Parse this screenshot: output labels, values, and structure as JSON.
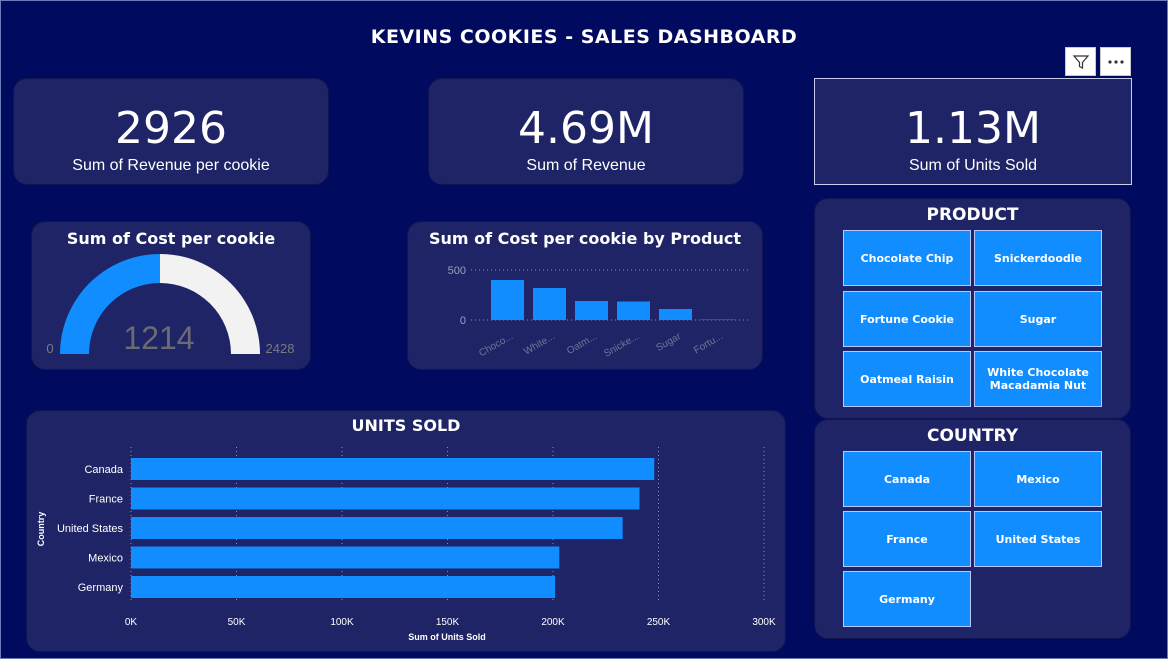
{
  "title": "KEVINS COOKIES - SALES DASHBOARD",
  "toolbar": {
    "filter_icon": "filter-icon",
    "more_icon": "more-options-icon"
  },
  "kpis": [
    {
      "value": "2926",
      "label": "Sum of Revenue per cookie"
    },
    {
      "value": "4.69M",
      "label": "Sum of Revenue"
    },
    {
      "value": "1.13M",
      "label": "Sum of Units Sold"
    }
  ],
  "gauge": {
    "title": "Sum of Cost per cookie",
    "value": 1214,
    "value_label": "1214",
    "min_label": "0",
    "max_label": "2428",
    "fill_fraction": 0.5,
    "colors": {
      "fill": "#118dff",
      "track": "#f2f2f2"
    }
  },
  "product_chart": {
    "title": "Sum of Cost per cookie by Product",
    "ytick_labels": [
      "500",
      "0"
    ]
  },
  "units_chart": {
    "title": "UNITS SOLD",
    "ylabel": "Country",
    "xlabel": "Sum of Units Sold"
  },
  "chart_data": [
    {
      "type": "bar",
      "title": "Sum of Cost per cookie by Product",
      "categories": [
        "Choco...",
        "White...",
        "Oatm...",
        "Snicke...",
        "Sugar",
        "Fortu..."
      ],
      "values": [
        400,
        320,
        190,
        185,
        110,
        5
      ],
      "ylim": [
        0,
        600
      ],
      "yticks": [
        0,
        500
      ],
      "grid": true
    },
    {
      "type": "bar",
      "orientation": "horizontal",
      "title": "UNITS SOLD",
      "categories": [
        "Canada",
        "France",
        "United States",
        "Mexico",
        "Germany"
      ],
      "values": [
        248000,
        241000,
        233000,
        203000,
        201000
      ],
      "xlabel": "Sum of Units Sold",
      "ylabel": "Country",
      "xlim": [
        0,
        300000
      ],
      "xtick_labels": [
        "0K",
        "50K",
        "100K",
        "150K",
        "200K",
        "250K",
        "300K"
      ],
      "grid": true,
      "color": "#118dff"
    }
  ],
  "product_slicer": {
    "title": "PRODUCT",
    "items": [
      "Chocolate Chip",
      "Snickerdoodle",
      "Fortune Cookie",
      "Sugar",
      "Oatmeal Raisin",
      "White Chocolate Macadamia Nut"
    ]
  },
  "country_slicer": {
    "title": "COUNTRY",
    "items": [
      "Canada",
      "Mexico",
      "France",
      "United States",
      "Germany"
    ]
  },
  "colors": {
    "background": "#000a5e",
    "card": "#1e2466",
    "accent": "#118dff"
  }
}
